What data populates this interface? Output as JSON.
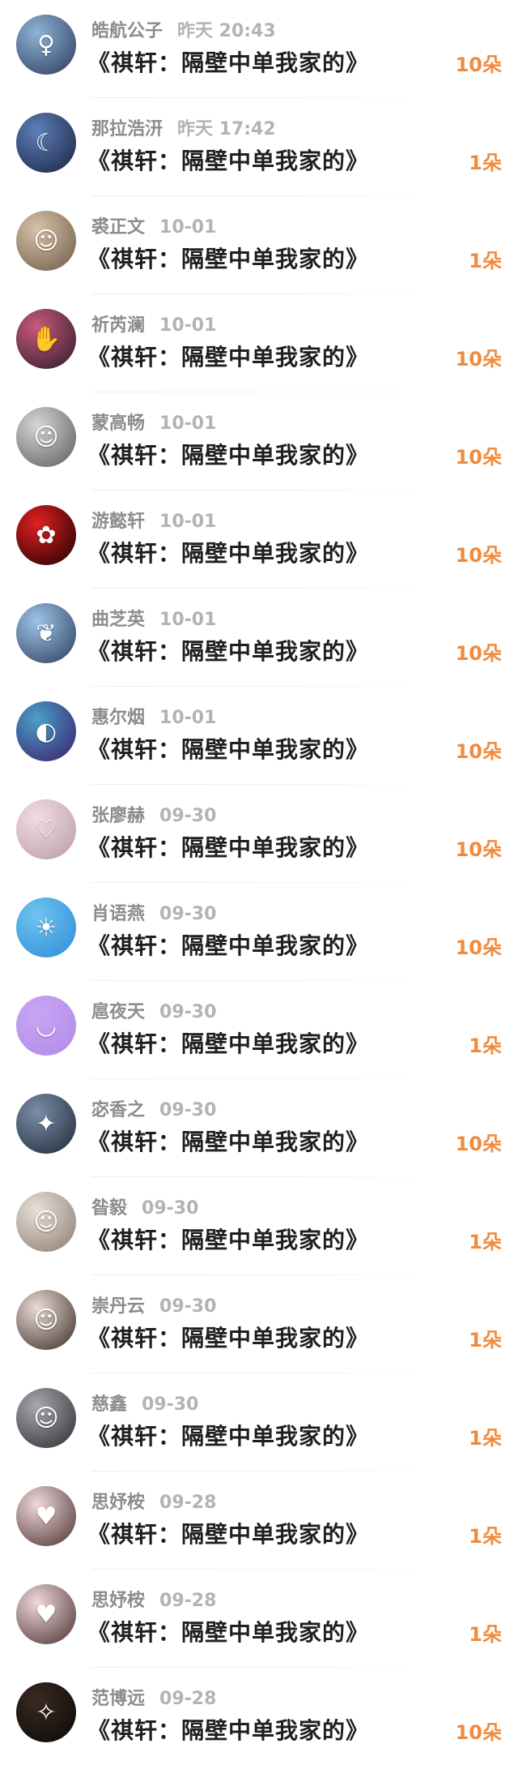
{
  "items": [
    {
      "name": "皓航公子",
      "time": "昨天 20:43",
      "title": "《祺轩：隔壁中单我家的》",
      "count": "10朵",
      "avatar": {
        "icon": "girl-blue-hair-avatar",
        "bg": "#8fb3d6",
        "bg2": "#2a3a5a",
        "glyph": "♀"
      }
    },
    {
      "name": "那拉浩汧",
      "time": "昨天 17:42",
      "title": "《祺轩：隔壁中单我家的》",
      "count": "1朵",
      "avatar": {
        "icon": "anime-dark-hair-avatar",
        "bg": "#5d7fb8",
        "bg2": "#1a2340",
        "glyph": "☾"
      }
    },
    {
      "name": "裘正文",
      "time": "10-01",
      "title": "《祺轩：隔壁中单我家的》",
      "count": "1朵",
      "avatar": {
        "icon": "woman-hat-avatar",
        "bg": "#d8c2a8",
        "bg2": "#6b5a48",
        "glyph": "☺"
      }
    },
    {
      "name": "祈芮澜",
      "time": "10-01",
      "title": "《祺轩：隔壁中单我家的》",
      "count": "10朵",
      "avatar": {
        "icon": "girl-hand-avatar",
        "bg": "#c85a7a",
        "bg2": "#2c1a2a",
        "glyph": "✋"
      }
    },
    {
      "name": "蒙高畅",
      "time": "10-01",
      "title": "《祺轩：隔壁中单我家的》",
      "count": "10朵",
      "avatar": {
        "icon": "bw-portrait-avatar",
        "bg": "#d6d6d6",
        "bg2": "#5a5a5a",
        "glyph": "☺"
      }
    },
    {
      "name": "游懿轩",
      "time": "10-01",
      "title": "《祺轩：隔壁中单我家的》",
      "count": "10朵",
      "avatar": {
        "icon": "red-flower-avatar",
        "bg": "#e02020",
        "bg2": "#1a0000",
        "glyph": "✿"
      }
    },
    {
      "name": "曲芝英",
      "time": "10-01",
      "title": "《祺轩：隔壁中单我家的》",
      "count": "10朵",
      "avatar": {
        "icon": "butterfly-avatar",
        "bg": "#9ec4e8",
        "bg2": "#2a3c5a",
        "glyph": "❦"
      }
    },
    {
      "name": "惠尔烟",
      "time": "10-01",
      "title": "《祺轩：隔壁中单我家的》",
      "count": "10朵",
      "avatar": {
        "icon": "planet-avatar",
        "bg": "#4aa0c8",
        "bg2": "#3a1a6a",
        "glyph": "◐"
      }
    },
    {
      "name": "张廖赫",
      "time": "09-30",
      "title": "《祺轩：隔壁中单我家的》",
      "count": "10朵",
      "avatar": {
        "icon": "anime-pink-hair-avatar",
        "bg": "#f2dde4",
        "bg2": "#b89aa8",
        "glyph": "♡"
      }
    },
    {
      "name": "肖语燕",
      "time": "09-30",
      "title": "《祺轩：隔壁中单我家的》",
      "count": "10朵",
      "avatar": {
        "icon": "sun-sky-avatar",
        "bg": "#6ec4f0",
        "bg2": "#2e8bd8",
        "glyph": "☀"
      }
    },
    {
      "name": "扈夜天",
      "time": "09-30",
      "title": "《祺轩：隔壁中单我家的》",
      "count": "1朵",
      "avatar": {
        "icon": "chat-bubble-face-avatar",
        "bg": "#c9a6f4",
        "bg2": "#b08ae8",
        "glyph": "◡"
      }
    },
    {
      "name": "宓香之",
      "time": "09-30",
      "title": "《祺轩：隔壁中单我家的》",
      "count": "10朵",
      "avatar": {
        "icon": "anime-night-avatar",
        "bg": "#7a8ea8",
        "bg2": "#1e2838",
        "glyph": "✦"
      }
    },
    {
      "name": "昝毅",
      "time": "09-30",
      "title": "《祺轩：隔壁中单我家的》",
      "count": "1朵",
      "avatar": {
        "icon": "couple-photo-avatar",
        "bg": "#e8e0d8",
        "bg2": "#8a7a70",
        "glyph": "☺"
      }
    },
    {
      "name": "崇丹云",
      "time": "09-30",
      "title": "《祺轩：隔壁中单我家的》",
      "count": "1朵",
      "avatar": {
        "icon": "girl-dark-hair-avatar",
        "bg": "#e8dcd4",
        "bg2": "#3a2a24",
        "glyph": "☺"
      }
    },
    {
      "name": "慈鑫",
      "time": "09-30",
      "title": "《祺轩：隔壁中单我家的》",
      "count": "1朵",
      "avatar": {
        "icon": "boy-scarf-avatar",
        "bg": "#a8a8b0",
        "bg2": "#2a2a30",
        "glyph": "☺"
      }
    },
    {
      "name": "思妤桉",
      "time": "09-28",
      "title": "《祺轩：隔壁中单我家的》",
      "count": "1朵",
      "avatar": {
        "icon": "couple-selfie-avatar",
        "bg": "#f0d8d8",
        "bg2": "#4a3030",
        "glyph": "♥"
      }
    },
    {
      "name": "思妤桉",
      "time": "09-28",
      "title": "《祺轩：隔壁中单我家的》",
      "count": "1朵",
      "avatar": {
        "icon": "couple-selfie-avatar",
        "bg": "#f0d8d8",
        "bg2": "#4a3030",
        "glyph": "♥"
      }
    },
    {
      "name": "范博远",
      "time": "09-28",
      "title": "《祺轩：隔壁中单我家的》",
      "count": "10朵",
      "avatar": {
        "icon": "night-street-avatar",
        "bg": "#3a2a20",
        "bg2": "#0a0808",
        "glyph": "✧"
      }
    }
  ]
}
